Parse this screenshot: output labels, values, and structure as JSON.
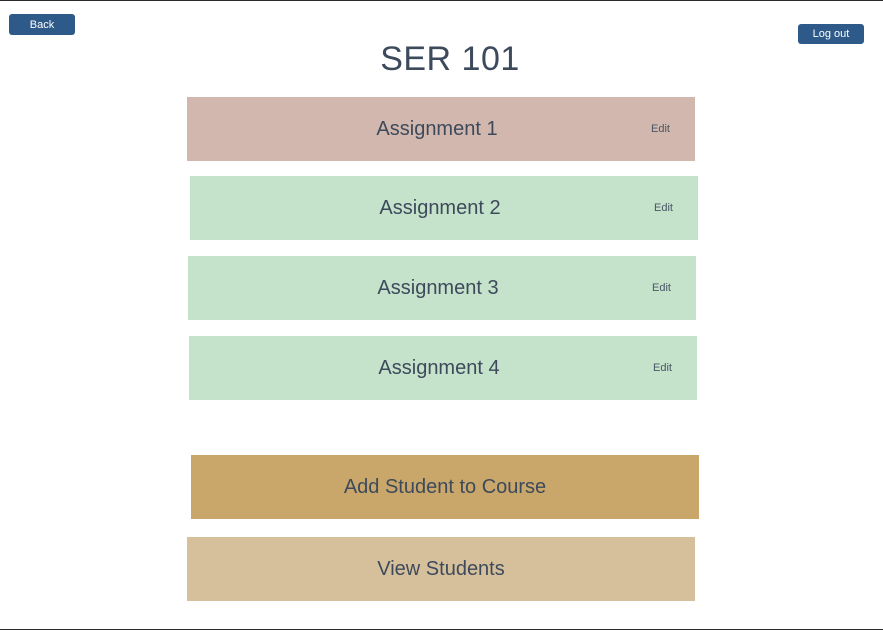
{
  "header": {
    "back_label": "Back",
    "logout_label": "Log out",
    "course_title": "SER 101"
  },
  "assignments": [
    {
      "label": "Assignment 1",
      "edit_label": "Edit",
      "color": "#d1b7ad"
    },
    {
      "label": "Assignment 2",
      "edit_label": "Edit",
      "color": "#c5e2cb"
    },
    {
      "label": "Assignment 3",
      "edit_label": "Edit",
      "color": "#c5e2cb"
    },
    {
      "label": "Assignment 4",
      "edit_label": "Edit",
      "color": "#c5e2cb"
    }
  ],
  "actions": {
    "add_student_label": "Add Student to Course",
    "add_student_color": "#c9a66a",
    "view_students_label": "View Students",
    "view_students_color": "#d6c09b"
  },
  "colors": {
    "nav_button": "#2e5a8a",
    "text": "#3d4a5c"
  }
}
